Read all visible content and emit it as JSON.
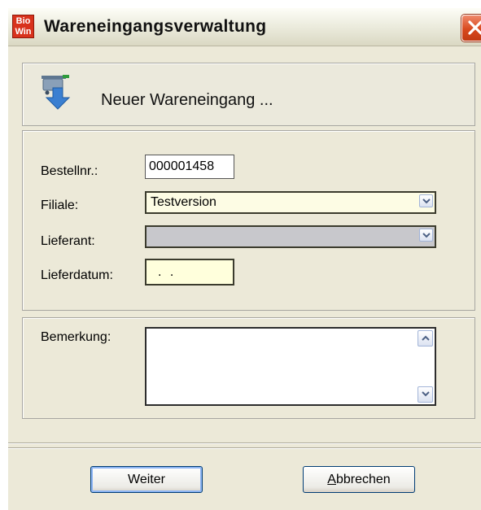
{
  "window": {
    "title": "Wareneingangsverwaltung",
    "app_icon_text": "Bio Win"
  },
  "header": {
    "heading": "Neuer Wareneingang ...",
    "icon": "cart-arrow-icon"
  },
  "form": {
    "order_label": "Bestellnr.:",
    "order_value": "000001458",
    "branch_label": "Filiale:",
    "branch_value": "Testversion",
    "supplier_label": "Lieferant:",
    "supplier_value": "",
    "date_label": "Lieferdatum:",
    "date_value": ". .",
    "remark_label": "Bemerkung:",
    "remark_value": ""
  },
  "buttons": {
    "next": "Weiter",
    "cancel": "Abbrechen",
    "cancel_mnemonic": "A"
  }
}
